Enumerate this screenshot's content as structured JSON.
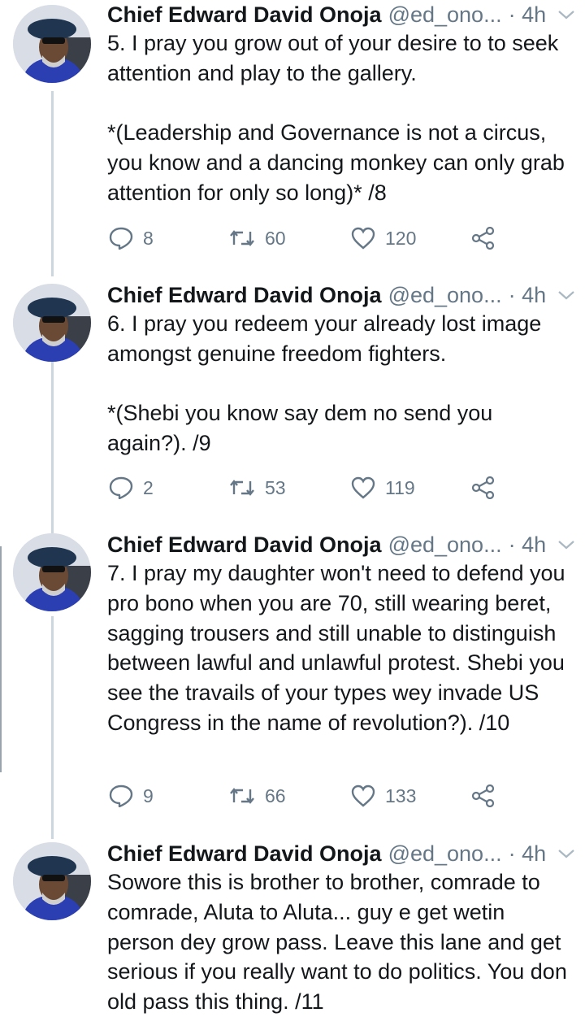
{
  "tweets": [
    {
      "author_name": "Chief Edward David Onoja",
      "author_handle": "@ed_ono...",
      "time": "· 4h",
      "text": "5. I pray you grow out of your desire to to seek attention and play to the gallery.\n\n*(Leadership and Governance is not a circus, you know and a dancing monkey can only grab attention for only so long)*  /8",
      "replies": "8",
      "retweets": "60",
      "likes": "120"
    },
    {
      "author_name": "Chief Edward David Onoja",
      "author_handle": "@ed_ono...",
      "time": "· 4h",
      "text": "6. I pray you redeem your already lost image amongst genuine freedom fighters.\n\n*(Shebi you know say dem no send you again?).  /9",
      "replies": "2",
      "retweets": "53",
      "likes": "119"
    },
    {
      "author_name": "Chief Edward David Onoja",
      "author_handle": "@ed_ono...",
      "time": "· 4h",
      "text": "7. I pray my daughter won't need to defend you pro bono when you are 70, still wearing beret, sagging trousers and still unable to distinguish between lawful and unlawful protest. Shebi you see the travails of your types wey invade US Congress in the name of revolution?).  /10",
      "replies": "9",
      "retweets": "66",
      "likes": "133"
    },
    {
      "author_name": "Chief Edward David Onoja",
      "author_handle": "@ed_ono...",
      "time": "· 4h",
      "text": "Sowore this is brother to brother, comrade to comrade, Aluta to Aluta... guy e get wetin person dey grow pass. Leave this lane and get serious if you really want to do politics. You don old pass this thing.  /11"
    }
  ],
  "icons": {
    "reply": "reply-icon",
    "retweet": "retweet-icon",
    "like": "heart-icon",
    "share": "share-icon",
    "more": "chevron-down-icon"
  },
  "colors": {
    "text": "#14171a",
    "secondary": "#657786",
    "thread_line": "#ccd6dd"
  }
}
